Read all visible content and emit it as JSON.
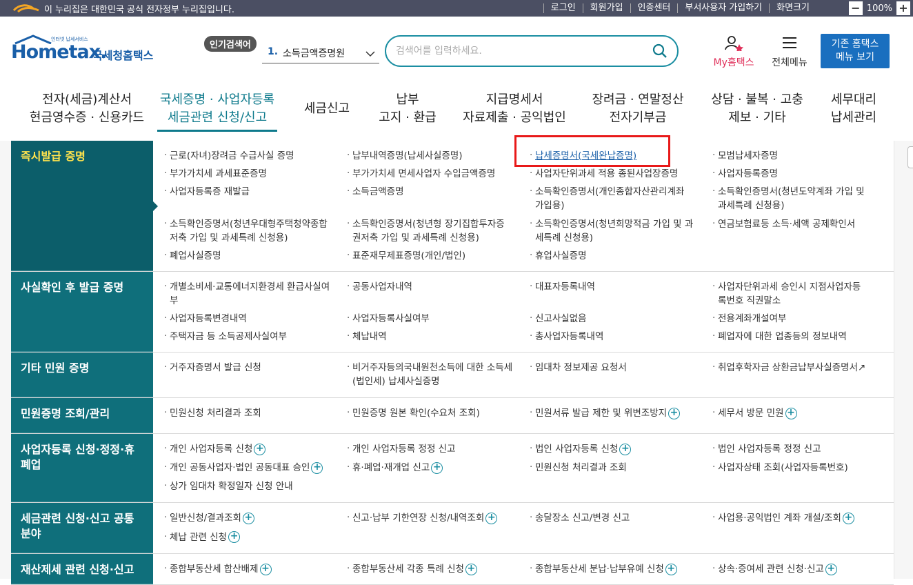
{
  "gov_bar": {
    "notice": "이 누리집은 대한민국 공식 전자정부 누리집입니다.",
    "links": [
      "로그인",
      "회원가입",
      "인증센터",
      "부서사용자 가입하기",
      "화면크기"
    ],
    "zoom_minus": "−",
    "zoom_level": "100%",
    "zoom_plus": "+"
  },
  "header": {
    "logo_sub": "인터넷 납세서비스",
    "logo_main": "Hometax.",
    "logo_kr": "국세청홈택스",
    "popular_label": "인기검색어",
    "popular_num": "1.",
    "popular_text": "소득금액증명원",
    "search_placeholder": "검색어를 입력하세요.",
    "my_hometax": "My홈택스",
    "all_menu": "전체메뉴",
    "old_hometax_line1": "기존 홈택스",
    "old_hometax_line2": "메뉴 보기"
  },
  "nav": [
    {
      "l1": "전자(세금)계산서",
      "l2": "현금영수증 · 신용카드"
    },
    {
      "l1": "국세증명 · 사업자등록",
      "l2": "세금관련 신청/신고"
    },
    {
      "l1": "세금신고",
      "l2": ""
    },
    {
      "l1": "납부",
      "l2": "고지 · 환급"
    },
    {
      "l1": "지급명세서",
      "l2": "자료제출 · 공익법인"
    },
    {
      "l1": "장려금 · 연말정산",
      "l2": "전자기부금"
    },
    {
      "l1": "상담 · 불복 · 고충",
      "l2": "제보 · 기타"
    },
    {
      "l1": "세무대리",
      "l2": "납세관리"
    }
  ],
  "sections": [
    {
      "title": "즉시발급 증명",
      "items": [
        {
          "t": "근로(자녀)장려금 수급사실 증명"
        },
        {
          "t": "납부내역증명(납세사실증명)"
        },
        {
          "t": "납세증명서(국세완납증명)"
        },
        {
          "t": "모범납세자증명"
        },
        {
          "t": "부가가치세 과세표준증명"
        },
        {
          "t": "부가가치세 면세사업자 수입금액증명"
        },
        {
          "t": "사업자단위과세 적용 종된사업장증명"
        },
        {
          "t": "사업자등록증명"
        },
        {
          "t": "사업자등록증 재발급"
        },
        {
          "t": "소득금액증명"
        },
        {
          "t": "소득확인증명서(개인종합자산관리계좌 가입용)"
        },
        {
          "t": "소득확인증명서(청년도약계좌 가입 및 과세특례 신청용)"
        },
        {
          "t": "소득확인증명서(청년우대형주택청약종합저축 가입 및 과세특례 신청용)"
        },
        {
          "t": "소득확인증명서(청년형 장기집합투자증권저축 가입 및 과세특례 신청용)"
        },
        {
          "t": "소득확인증명서(청년희망적금 가입 및 과세특례 신청용)"
        },
        {
          "t": "연금보험료등 소득·세액 공제확인서"
        },
        {
          "t": "폐업사실증명"
        },
        {
          "t": "표준재무제표증명(개인/법인)"
        },
        {
          "t": "휴업사실증명"
        },
        {
          "t": ""
        }
      ]
    },
    {
      "title": "사실확인 후 발급 증명",
      "items": [
        {
          "t": "개별소비세·교통에너지환경세 환급사실여부"
        },
        {
          "t": "공동사업자내역"
        },
        {
          "t": "대표자등록내역"
        },
        {
          "t": "사업자단위과세 승인시 지점사업자등록번호 직권말소"
        },
        {
          "t": "사업자등록변경내역"
        },
        {
          "t": "사업자등록사실여부"
        },
        {
          "t": "신고사실없음"
        },
        {
          "t": "전용계좌개설여부"
        },
        {
          "t": "주택자금 등 소득공제사실여부"
        },
        {
          "t": "체납내역"
        },
        {
          "t": "총사업자등록내역"
        },
        {
          "t": "폐업자에 대한 업종등의 정보내역"
        }
      ]
    },
    {
      "title": "기타 민원 증명",
      "items": [
        {
          "t": "거주자증명서 발급 신청"
        },
        {
          "t": "비거주자등의국내원천소득에 대한 소득세(법인세) 납세사실증명"
        },
        {
          "t": "임대차 정보제공 요청서"
        },
        {
          "t": "취업후학자금 상환금납부사실증명서",
          "ext": "↗"
        }
      ]
    },
    {
      "title": "민원증명 조회/관리",
      "items": [
        {
          "t": "민원신청 처리결과 조회"
        },
        {
          "t": "민원증명 원본 확인(수요처 조회)"
        },
        {
          "t": "민원서류 발급 제한 및 위변조방지",
          "plus": "+"
        },
        {
          "t": "세무서 방문 민원",
          "plus": "+"
        }
      ]
    },
    {
      "title": "사업자등록 신청·정정·휴폐업",
      "items": [
        {
          "t": "개인 사업자등록 신청",
          "plus": "+"
        },
        {
          "t": "개인 사업자등록 정정 신고"
        },
        {
          "t": "법인 사업자등록 신청",
          "plus": "+"
        },
        {
          "t": "법인 사업자등록 정정 신고"
        },
        {
          "t": "개인 공동사업자·법인 공동대표 승인",
          "plus": "+"
        },
        {
          "t": "휴·폐업·재개업 신고",
          "plus": "+"
        },
        {
          "t": "민원신청 처리결과 조회"
        },
        {
          "t": "사업자상태 조회(사업자등록번호)"
        },
        {
          "t": "상가 임대차 확정일자 신청 안내"
        }
      ]
    },
    {
      "title": "세금관련 신청·신고 공통분야",
      "items": [
        {
          "t": "일반신청/결과조회",
          "plus": "+"
        },
        {
          "t": "신고·납부 기한연장 신청/내역조회",
          "plus": "+"
        },
        {
          "t": "송달장소 신고/변경 신고"
        },
        {
          "t": "사업용·공익법인 계좌 개설/조회",
          "plus": "+"
        },
        {
          "t": "체납 관련 신청",
          "plus": "+"
        }
      ]
    },
    {
      "title": "재산제세 관련 신청·신고",
      "items": [
        {
          "t": "종합부동산세 합산배제",
          "plus": "+"
        },
        {
          "t": "종합부동산세 각종 특례 신청",
          "plus": "+"
        },
        {
          "t": "종합부동산세 분납·납부유예 신청",
          "plus": "+"
        },
        {
          "t": "상속·증여세 관련 신청·신고",
          "plus": "+"
        }
      ]
    }
  ]
}
